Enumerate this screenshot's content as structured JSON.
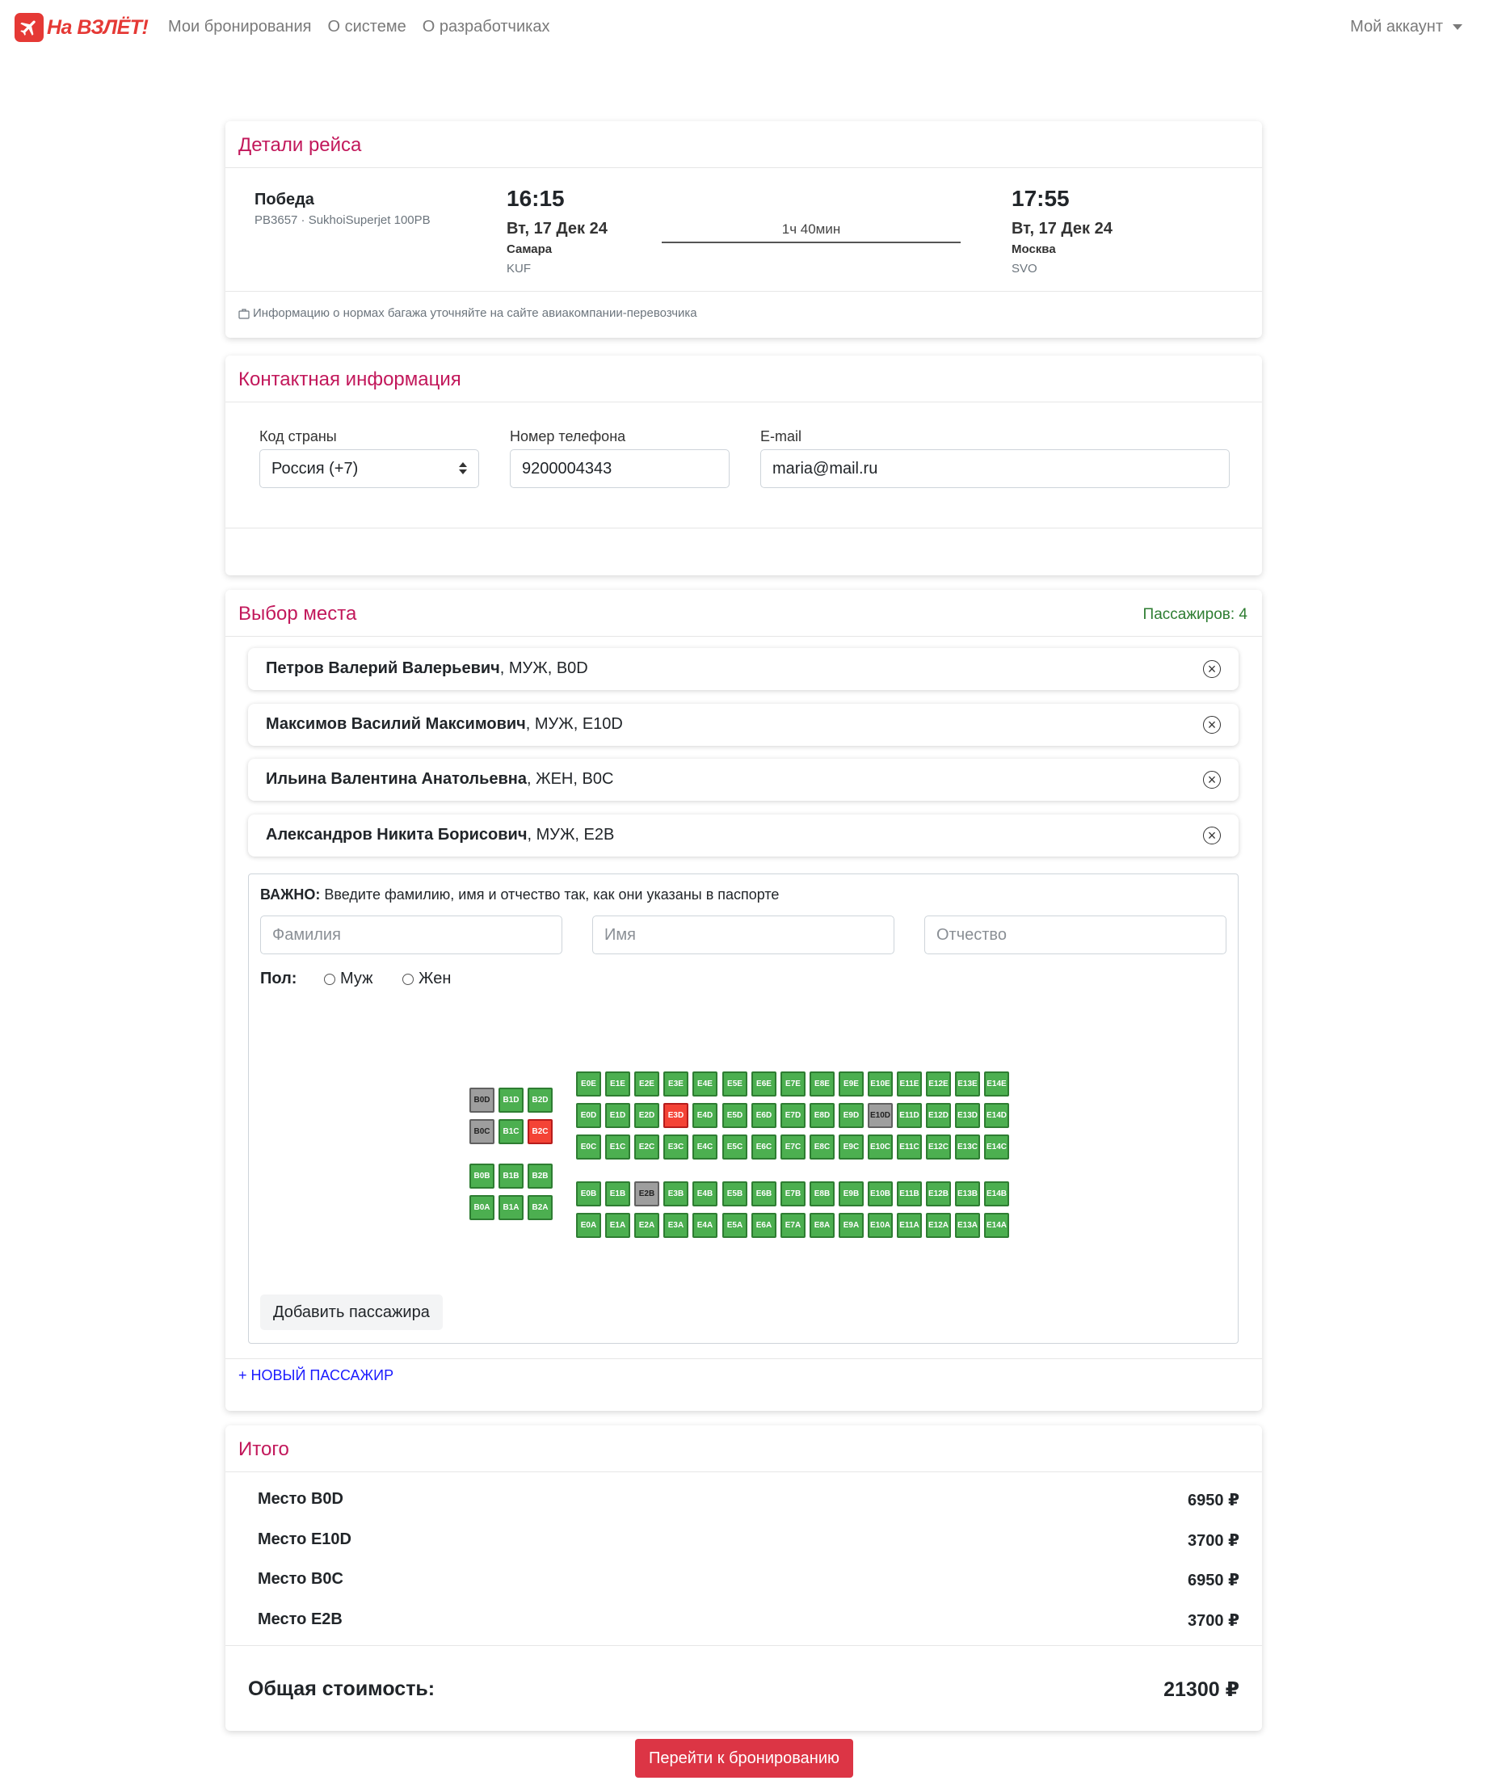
{
  "navbar": {
    "brand": "На ВЗЛЁТ!",
    "links": [
      "Мои бронирования",
      "О системе",
      "О разработчиках"
    ],
    "account": "Мой аккаунт"
  },
  "flight": {
    "title": "Детали рейса",
    "airline": "Победа",
    "flight_info": "PB3657 · SukhoiSuperjet 100PB",
    "departure": {
      "time": "16:15",
      "date": "Вт, 17 Дек 24",
      "city": "Самара",
      "code": "KUF"
    },
    "arrival": {
      "time": "17:55",
      "date": "Вт, 17 Дек 24",
      "city": "Москва",
      "code": "SVO"
    },
    "duration": "1ч 40мин",
    "baggage_note": "Информацию о нормах багажа уточняйте на сайте авиакомпании-перевозчика"
  },
  "contact": {
    "title": "Контактная информация",
    "country_label": "Код страны",
    "country_value": "Россия (+7)",
    "phone_label": "Номер телефона",
    "phone_value": "9200004343",
    "email_label": "E-mail",
    "email_value": "maria@mail.ru"
  },
  "seats_section": {
    "title": "Выбор места",
    "passenger_count": "Пассажиров: 4",
    "passengers": [
      {
        "name": "Петров Валерий Валерьевич",
        "details": ", МУЖ, B0D"
      },
      {
        "name": "Максимов Василий Максимович",
        "details": ", МУЖ, E10D"
      },
      {
        "name": "Ильина Валентина Анатольевна",
        "details": ", ЖЕН, B0C"
      },
      {
        "name": "Александров Никита Борисович",
        "details": ", МУЖ, E2B"
      }
    ],
    "important_bold": "ВАЖНО:",
    "important_text": " Введите фамилию, имя и отчество так, как они указаны в паспорте",
    "placeholders": {
      "last_name": "Фамилия",
      "first_name": "Имя",
      "middle_name": "Отчество"
    },
    "gender_label": "Пол:",
    "gender_male": "Муж",
    "gender_female": "Жен",
    "add_passenger": "Добавить пассажира",
    "new_passenger_link": "+ НОВЫЙ ПАССАЖИР",
    "seat_map": {
      "business_cols": [
        "0",
        "1",
        "2"
      ],
      "business_rows": [
        "D",
        "C",
        "B",
        "A"
      ],
      "economy_cols": [
        "0",
        "1",
        "2",
        "3",
        "4",
        "5",
        "6",
        "7",
        "8",
        "9",
        "10",
        "11",
        "12",
        "13",
        "14"
      ],
      "economy_rows": [
        "E",
        "D",
        "C",
        "B",
        "A"
      ],
      "occupied": [
        "B0D",
        "B0C",
        "E10D",
        "E2B"
      ],
      "selected": [
        "B2C",
        "E3D"
      ],
      "colors": {
        "free": "#4caf50",
        "occupied": "#9e9e9e",
        "selected": "#f44336"
      }
    }
  },
  "summary": {
    "title": "Итого",
    "items": [
      {
        "label": "Место B0D",
        "price": "6950 ₽"
      },
      {
        "label": "Место E10D",
        "price": "3700 ₽"
      },
      {
        "label": "Место B0C",
        "price": "6950 ₽"
      },
      {
        "label": "Место E2B",
        "price": "3700 ₽"
      }
    ],
    "total_label": "Общая стоимость:",
    "total_value": "21300 ₽"
  },
  "submit_button": "Перейти к бронированию",
  "colors": {
    "accent": "#c2185b",
    "brand": "#e53935",
    "count": "#2e7d32",
    "link": "#1a1aff",
    "submit": "#dc3545"
  }
}
